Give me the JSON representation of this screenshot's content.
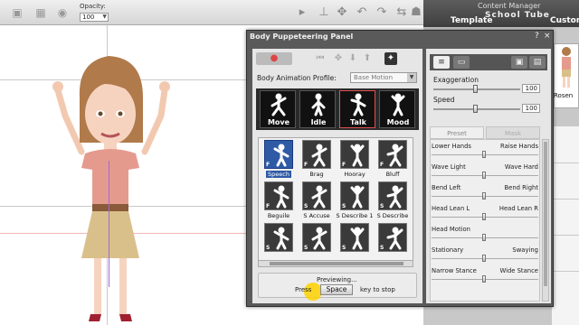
{
  "toolbar": {
    "opacity_label": "Opacity:",
    "opacity_value": "100",
    "icons": [
      "layers-icon",
      "move-icon",
      "eye-icon",
      "select-icon",
      "flip-icon",
      "rotate-icon",
      "undo-icon"
    ]
  },
  "right_panel": {
    "header": "Content Manager",
    "tab_template": "Template",
    "tab_custom": "Custom",
    "watermark": "School Tube",
    "item_label": "Rosen"
  },
  "panel": {
    "title": "Body Puppeteering Panel",
    "help": "?",
    "close": "×",
    "profile_label": "Body Animation Profile:",
    "profile_value": "Base Motion",
    "categories": [
      {
        "label": "Move",
        "selected": false
      },
      {
        "label": "Idle",
        "selected": false
      },
      {
        "label": "Talk",
        "selected": true
      },
      {
        "label": "Mood",
        "selected": false
      }
    ],
    "motions": [
      {
        "label": "Speech",
        "badge": "F",
        "selected": true
      },
      {
        "label": "Brag",
        "badge": "F",
        "selected": false
      },
      {
        "label": "Hooray",
        "badge": "F",
        "selected": false
      },
      {
        "label": "Bluff",
        "badge": "F",
        "selected": false
      },
      {
        "label": "Beguile",
        "badge": "F",
        "selected": false
      },
      {
        "label": "S Accuse",
        "badge": "S",
        "selected": false
      },
      {
        "label": "S Describe 1",
        "badge": "S",
        "selected": false
      },
      {
        "label": "S Describe",
        "badge": "S",
        "selected": false
      },
      {
        "label": "",
        "badge": "S",
        "selected": false
      },
      {
        "label": "",
        "badge": "S",
        "selected": false
      },
      {
        "label": "",
        "badge": "S",
        "selected": false
      },
      {
        "label": "",
        "badge": "S",
        "selected": false
      }
    ],
    "previewing": "Previewing...",
    "press": "Press",
    "space_key": "Space",
    "key_to_stop": "key to stop",
    "exaggeration_label": "Exaggeration",
    "exaggeration_value": "100",
    "speed_label": "Speed",
    "speed_value": "100",
    "tab_preset": "Preset",
    "tab_mask": "Mask",
    "pairs": [
      {
        "left": "Lower Hands",
        "right": "Raise Hands"
      },
      {
        "left": "Wave Light",
        "right": "Wave Hard"
      },
      {
        "left": "Bend Left",
        "right": "Bend Right"
      },
      {
        "left": "Head Lean L",
        "right": "Head Lean R"
      },
      {
        "left": "Head Motion",
        "right": ""
      },
      {
        "left": "Stationary",
        "right": "Swaying"
      },
      {
        "left": "Narrow Stance",
        "right": "Wide Stance"
      }
    ]
  }
}
